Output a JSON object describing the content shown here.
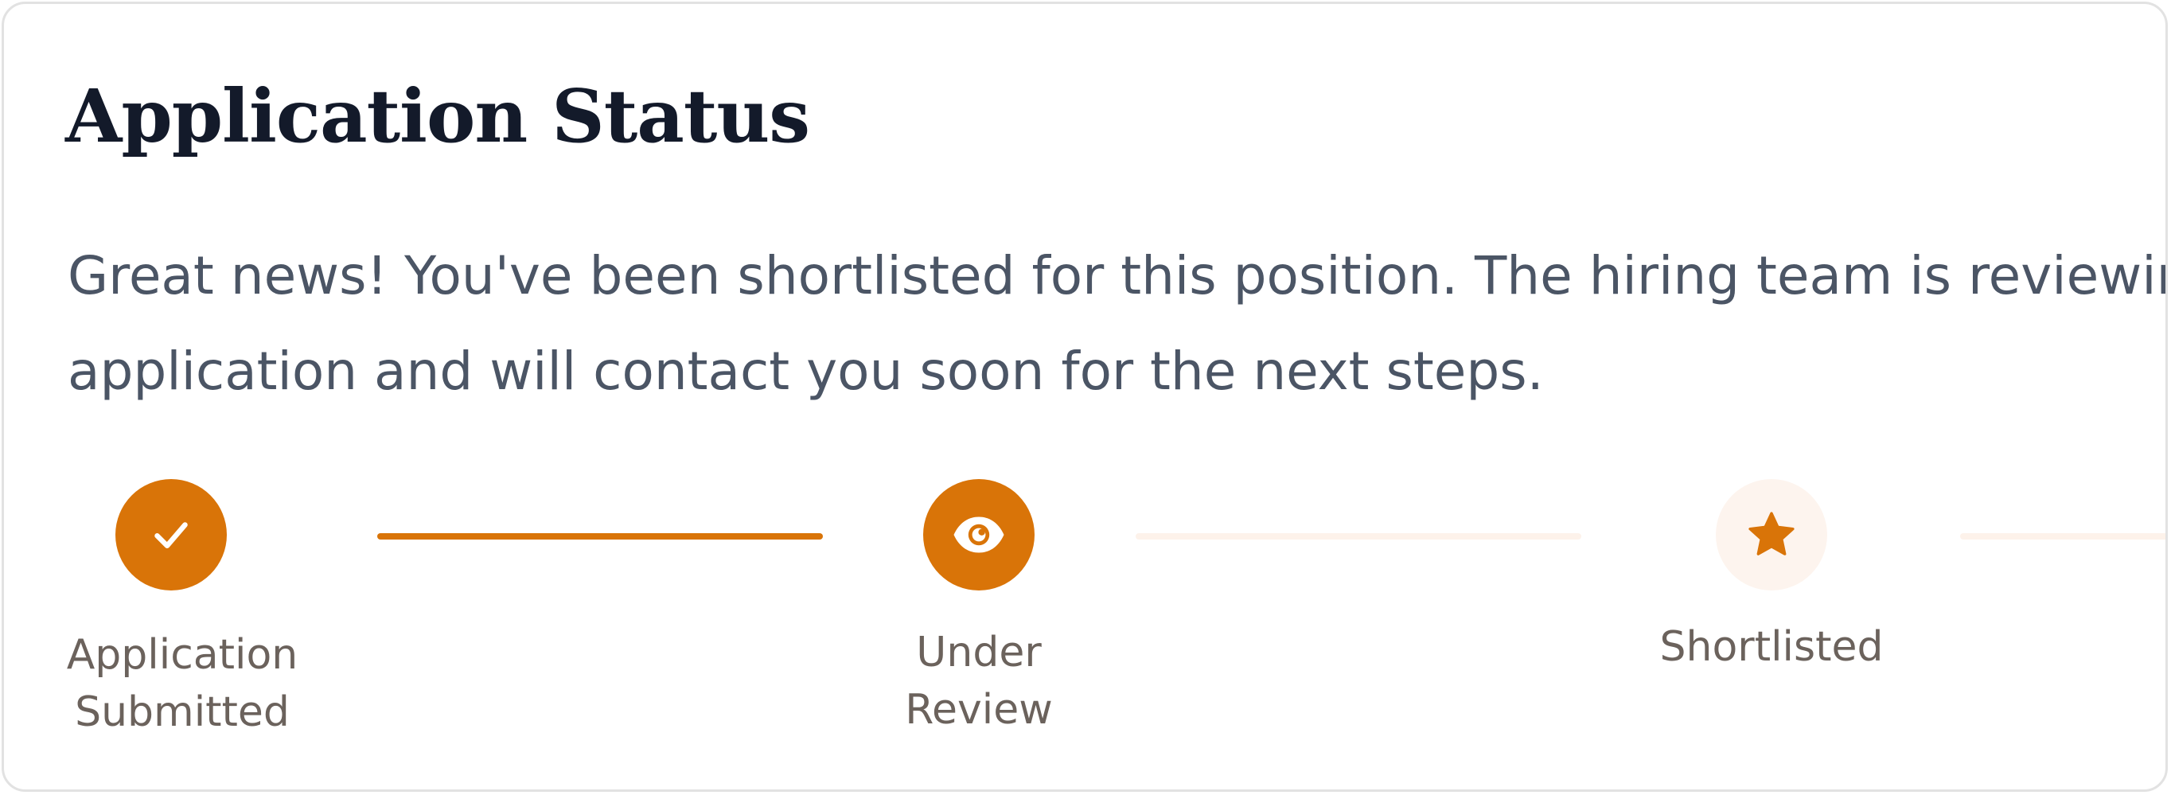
{
  "card": {
    "title": "Application Status",
    "message": "Great news! You've been shortlisted for this position. The hiring team is reviewing your application and will contact you soon for the next steps."
  },
  "progress": {
    "steps": [
      {
        "label_line1": "Application",
        "label_line2": "Submitted",
        "icon": "check-icon",
        "state": "completed"
      },
      {
        "label_line1": "Under",
        "label_line2": "Review",
        "icon": "eye-icon",
        "state": "completed"
      },
      {
        "label_line1": "Shortlisted",
        "label_line2": "",
        "icon": "star-icon",
        "state": "current"
      }
    ],
    "connectors": [
      {
        "state": "filled"
      },
      {
        "state": "empty"
      },
      {
        "state": "empty"
      }
    ]
  },
  "colors": {
    "accent": "#d97408",
    "accent_light": "#fdf4ee",
    "title": "#131a2a",
    "body_text": "#4b5565",
    "label_text": "#6b625c",
    "border": "#e2e2e2"
  }
}
